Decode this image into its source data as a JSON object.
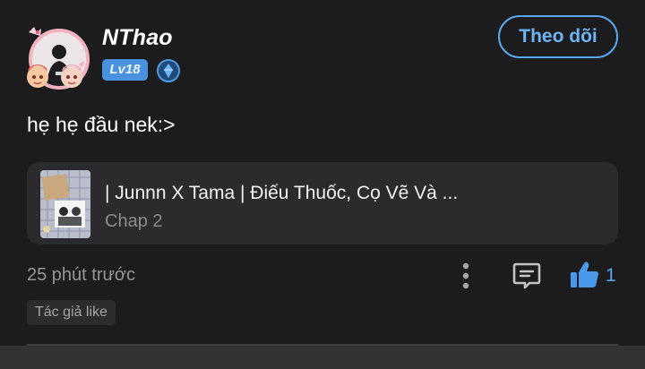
{
  "post": {
    "author": {
      "name": "NThao",
      "level": "Lv18",
      "avatar_icon": "anime-avatar-icon",
      "rank_icon": "rank-diamond-icon"
    },
    "follow_label": "Theo dõi",
    "content": "hẹ hẹ đầu nek:>",
    "story": {
      "title": "| Junnn X Tama | Điếu Thuốc, Cọ Vẽ Và ...",
      "chapter": "Chap 2",
      "cover_icon": "story-cover-thumbnail"
    },
    "time": "25 phút trước",
    "likes": "1",
    "tag": "Tác giả like",
    "icons": {
      "more": "more-vertical-icon",
      "comment": "comment-icon",
      "like": "thumbs-up-icon"
    },
    "colors": {
      "background": "#1c1c1e",
      "card": "#2b2b2e",
      "accent": "#5aa7f0",
      "level_badge": "#4a92df"
    }
  }
}
